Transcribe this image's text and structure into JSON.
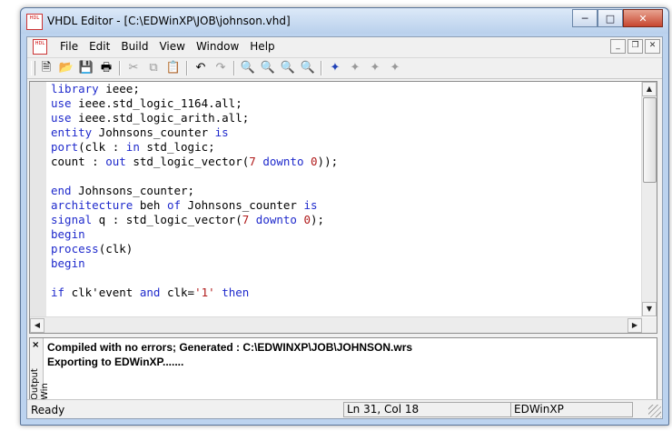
{
  "window": {
    "title": "VHDL Editor - [C:\\EDWinXP\\JOB\\johnson.vhd]",
    "icon": "hdl-file-icon"
  },
  "menubar": {
    "items": [
      "File",
      "Edit",
      "Build",
      "View",
      "Window",
      "Help"
    ]
  },
  "toolbar": {
    "buttons": [
      "new-icon",
      "open-icon",
      "save-icon",
      "print-icon",
      "cut-icon",
      "copy-icon",
      "paste-icon",
      "undo-icon",
      "redo-icon",
      "find-icon",
      "find-next-icon",
      "replace-icon",
      "find-all-icon",
      "bookmark-toggle-icon",
      "bookmark-next-icon",
      "bookmark-prev-icon",
      "bookmark-clear-icon"
    ]
  },
  "editor": {
    "lines": [
      [
        [
          "library",
          "kw"
        ],
        [
          " ieee;",
          ""
        ]
      ],
      [
        [
          "use",
          "kw"
        ],
        [
          " ieee.std_logic_1164.all;",
          ""
        ]
      ],
      [
        [
          "use",
          "kw"
        ],
        [
          " ieee.std_logic_arith.all;",
          ""
        ]
      ],
      [
        [
          "entity",
          "kw"
        ],
        [
          " Johnsons_counter ",
          ""
        ],
        [
          "is",
          "kw"
        ]
      ],
      [
        [
          "port",
          "kw"
        ],
        [
          "(clk : ",
          ""
        ],
        [
          "in",
          "kw"
        ],
        [
          " std_logic;",
          ""
        ]
      ],
      [
        [
          "count : ",
          ""
        ],
        [
          "out",
          "kw"
        ],
        [
          " std_logic_vector(",
          ""
        ],
        [
          "7",
          "num"
        ],
        [
          " ",
          ""
        ],
        [
          "downto",
          "kw"
        ],
        [
          " ",
          ""
        ],
        [
          "0",
          "num"
        ],
        [
          "));",
          ""
        ]
      ],
      [],
      [
        [
          "end",
          "kw"
        ],
        [
          " Johnsons_counter;",
          ""
        ]
      ],
      [
        [
          "architecture",
          "kw"
        ],
        [
          " beh ",
          ""
        ],
        [
          "of",
          "kw"
        ],
        [
          " Johnsons_counter ",
          ""
        ],
        [
          "is",
          "kw"
        ]
      ],
      [
        [
          "signal",
          "kw"
        ],
        [
          " q : std_logic_vector(",
          ""
        ],
        [
          "7",
          "num"
        ],
        [
          " ",
          ""
        ],
        [
          "downto",
          "kw"
        ],
        [
          " ",
          ""
        ],
        [
          "0",
          "num"
        ],
        [
          ");",
          ""
        ]
      ],
      [
        [
          "begin",
          "kw"
        ]
      ],
      [
        [
          "process",
          "kw"
        ],
        [
          "(clk)",
          ""
        ]
      ],
      [
        [
          "begin",
          "kw"
        ]
      ],
      [],
      [
        [
          "if",
          "kw"
        ],
        [
          " clk'event ",
          ""
        ],
        [
          "and",
          "kw"
        ],
        [
          " clk=",
          ""
        ],
        [
          "'1'",
          "num"
        ],
        [
          " ",
          ""
        ],
        [
          "then",
          "kw"
        ]
      ]
    ]
  },
  "output": {
    "label": "Output Win",
    "close": "×",
    "lines": [
      "Compiled with no errors; Generated : C:\\EDWINXP\\JOB\\JOHNSON.wrs",
      "Exporting to EDWinXP......."
    ]
  },
  "statusbar": {
    "status": "Ready",
    "position": "Ln 31, Col 18",
    "app": "EDWinXP"
  }
}
